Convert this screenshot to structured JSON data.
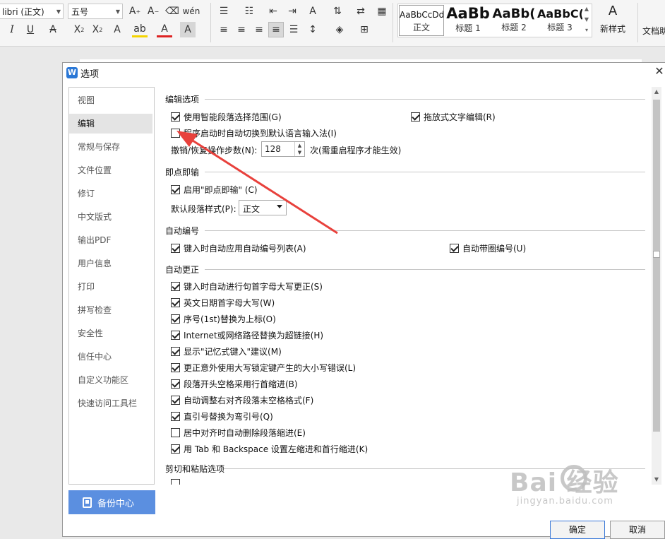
{
  "ribbon": {
    "font_name": "libri (正文)",
    "font_size": "五号",
    "styles": [
      {
        "sample": "AaBbCcDd",
        "caption": "正文"
      },
      {
        "sample": "AaBb",
        "caption": "标题 1"
      },
      {
        "sample": "AaBb(",
        "caption": "标题 2"
      },
      {
        "sample": "AaBbC(",
        "caption": "标题 3"
      }
    ],
    "new_style_label": "新样式",
    "doc_assist_label": "文档助"
  },
  "dialog": {
    "title": "选项",
    "nav_items": [
      "视图",
      "编辑",
      "常规与保存",
      "文件位置",
      "修订",
      "中文版式",
      "输出PDF",
      "用户信息",
      "打印",
      "拼写检查",
      "安全性",
      "信任中心",
      "自定义功能区",
      "快速访问工具栏"
    ],
    "active_nav": "编辑",
    "backup_label": "备份中心",
    "ok_label": "确定",
    "cancel_label": "取消"
  },
  "sections": {
    "edit": {
      "title": "编辑选项",
      "smart_select": "使用智能段落选择范围(G)",
      "drag_edit": "拖放式文字编辑(R)",
      "auto_ime": "程序启动时自动切换到默认语言输入法(I)",
      "undo_label": "撤销/恢复操作步数(N):",
      "undo_value": "128",
      "undo_note": "次(需重启程序才能生效)"
    },
    "click_type": {
      "title": "即点即输",
      "enable": "启用\"即点即输\" (C)",
      "para_style_label": "默认段落样式(P):",
      "para_style_value": "正文"
    },
    "auto_number": {
      "title": "自动编号",
      "apply_list": "键入时自动应用自动编号列表(A)",
      "circled": "自动带圈编号(U)"
    },
    "auto_correct": {
      "title": "自动更正",
      "items": [
        {
          "label": "键入时自动进行句首字母大写更正(S)",
          "checked": true
        },
        {
          "label": "英文日期首字母大写(W)",
          "checked": true
        },
        {
          "label": "序号(1st)替换为上标(O)",
          "checked": true
        },
        {
          "label": "Internet或网络路径替换为超链接(H)",
          "checked": true
        },
        {
          "label": "显示\"记忆式键入\"建议(M)",
          "checked": true
        },
        {
          "label": "更正意外使用大写锁定键产生的大小写错误(L)",
          "checked": true
        },
        {
          "label": "段落开头空格采用行首缩进(B)",
          "checked": true
        },
        {
          "label": "自动调整右对齐段落末空格格式(F)",
          "checked": true
        },
        {
          "label": "直引号替换为弯引号(Q)",
          "checked": true
        },
        {
          "label": "居中对齐时自动删除段落缩进(E)",
          "checked": false
        },
        {
          "label": "用 Tab 和 Backspace 设置左缩进和首行缩进(K)",
          "checked": true
        }
      ]
    },
    "cut_paste": {
      "title": "剪切和粘贴选项"
    }
  },
  "watermark": {
    "brand": "Bai  经验",
    "url": "jingyan.baidu.com"
  },
  "colors": {
    "accent": "#5b8fe0",
    "annotation_arrow": "#e8413c",
    "app_icon": "#2b78d6"
  }
}
